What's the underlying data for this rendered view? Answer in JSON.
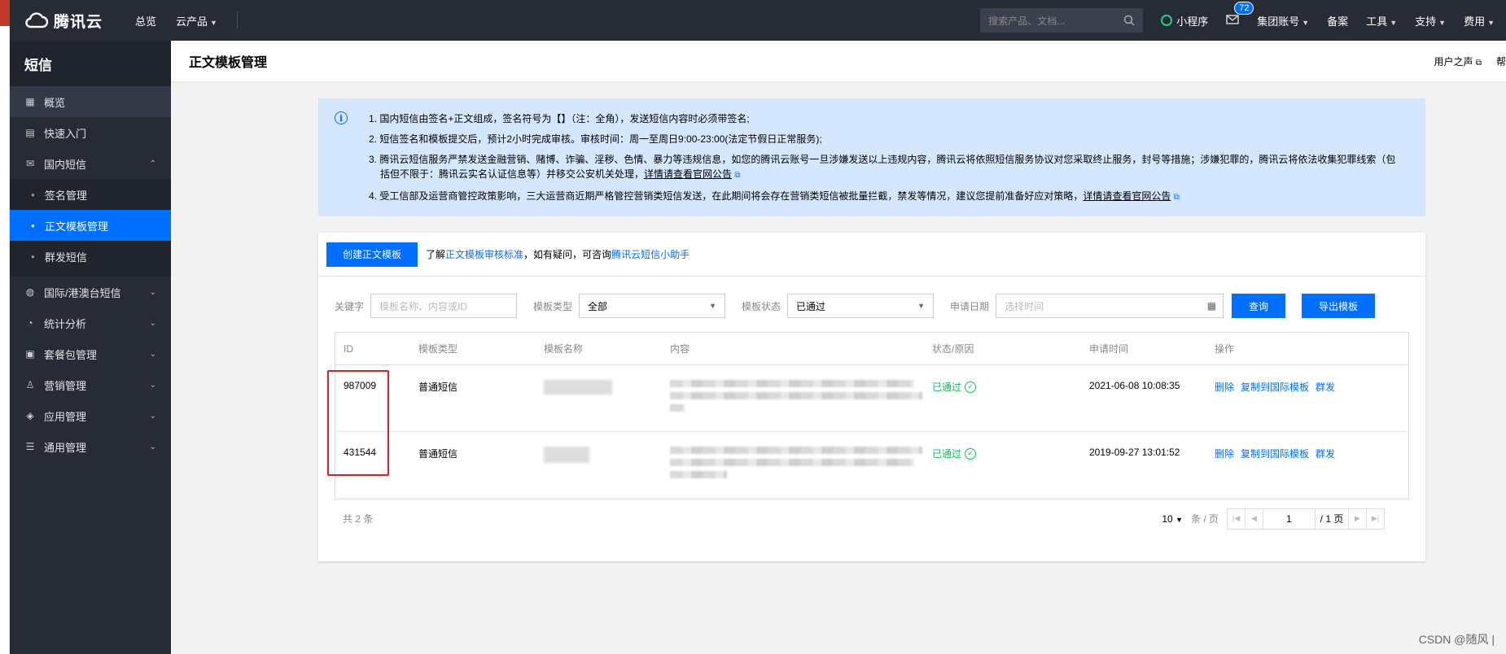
{
  "topbar": {
    "brand": "腾讯云",
    "nav": [
      "总览",
      "云产品"
    ],
    "search_placeholder": "搜索产品、文档...",
    "mini_program": "小程序",
    "mail_badge": "72",
    "links": [
      "集团账号",
      "备案",
      "工具",
      "支持",
      "费用"
    ]
  },
  "sidebar": {
    "title": "短信",
    "items": [
      {
        "label": "概览",
        "icon": "grid-icon"
      },
      {
        "label": "快速入门",
        "icon": "book-icon"
      },
      {
        "label": "国内短信",
        "icon": "mail-icon"
      }
    ],
    "sub_items": [
      "签名管理",
      "正文模板管理",
      "群发短信"
    ],
    "more_items": [
      {
        "label": "国际/港澳台短信",
        "icon": "globe-icon"
      },
      {
        "label": "统计分析",
        "icon": "pie-chart-icon"
      },
      {
        "label": "套餐包管理",
        "icon": "package-icon"
      },
      {
        "label": "营销管理",
        "icon": "user-icon"
      },
      {
        "label": "应用管理",
        "icon": "layers-icon"
      },
      {
        "label": "通用管理",
        "icon": "sliders-icon"
      }
    ]
  },
  "header": {
    "title": "正文模板管理",
    "user_voice": "用户之声",
    "help": "帮"
  },
  "alert": {
    "line1": "1. 国内短信由签名+正文组成，签名符号为【】（注：全角），发送短信内容时必须带签名;",
    "line2": "2. 短信签名和模板提交后，预计2小时完成审核。审核时间：周一至周日9:00-23:00(法定节假日正常服务);",
    "line3a": "3. 腾讯云短信服务严禁发送金融营销、赌博、诈骗、淫秽、色情、暴力等违规信息，如您的腾讯云账号一旦涉嫌发送以上违规内容，腾讯云将依照短信服务协议对您采取终止服务，封号等措施；涉嫌犯罪的，腾讯云将依法收集犯罪线索（包",
    "line3b": "括但不限于：腾讯云实名认证信息等）并移交公安机关处理，",
    "line3_link": "详情请查看官网公告",
    "line4": "4. 受工信部及运营商管控政策影响，三大运营商近期严格管控营销类短信发送，在此期间将会存在营销类短信被批量拦截，禁发等情况，建议您提前准备好应对策略，",
    "line4_link": "详情请查看官网公告"
  },
  "card": {
    "create_button": "创建正文模板",
    "hint_prefix": "了解",
    "hint_link1": "正文模板审核标准",
    "hint_mid": "，如有疑问，可咨询",
    "hint_link2": "腾讯云短信小助手"
  },
  "filters": {
    "keyword_label": "关键字",
    "keyword_placeholder": "模板名称、内容或ID",
    "type_label": "模板类型",
    "type_value": "全部",
    "status_label": "模板状态",
    "status_value": "已通过",
    "date_label": "申请日期",
    "date_placeholder": "选择时间",
    "search_button": "查询",
    "export_button": "导出模板"
  },
  "table": {
    "columns": [
      "ID",
      "模板类型",
      "模板名称",
      "内容",
      "状态/原因",
      "申请时间",
      "操作"
    ],
    "rows": [
      {
        "id": "987009",
        "type": "普通短信",
        "status": "已通过",
        "time": "2021-06-08 10:08:35",
        "ops": [
          "删除",
          "复制到国际模板",
          "群发"
        ]
      },
      {
        "id": "431544",
        "type": "普通短信",
        "status": "已通过",
        "time": "2019-09-27 13:01:52",
        "ops": [
          "删除",
          "复制到国际模板",
          "群发"
        ]
      }
    ]
  },
  "footer": {
    "total": "共 2 条",
    "page_size": "10",
    "per_page": "条 / 页",
    "page": "1",
    "total_pages": "/ 1 页"
  },
  "watermark": "CSDN @随风 |",
  "colors": {
    "primary": "#006eff",
    "success": "#0abf5b",
    "highlight": "#e02020",
    "dark": "#262b36"
  }
}
